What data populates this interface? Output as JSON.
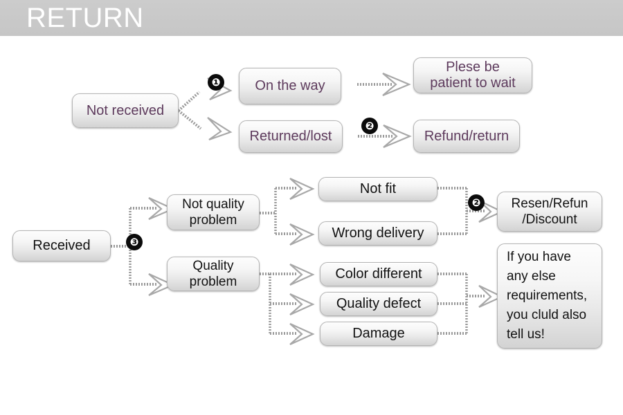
{
  "header": {
    "title": "RETURN",
    "bar_color": "#c8c8c8",
    "title_color": "#ffffff"
  },
  "theme": {
    "purple_text": "#5d3a5c",
    "black_text": "#111111",
    "box_border": "#b4b4b4",
    "connector": "#9a9a9a",
    "badge_bg": "#0b0b0b"
  },
  "nodes": {
    "not_received": "Not received",
    "on_the_way": "On the way",
    "returned_lost": "Returned/lost",
    "please_wait": "Plese be\npatient to wait",
    "refund_return": "Refund/return",
    "received": "Received",
    "not_quality_problem": "Not quality\nproblem",
    "quality_problem": "Quality\nproblem",
    "not_fit": "Not fit",
    "wrong_delivery": "Wrong delivery",
    "color_different": "Color different",
    "quality_defect": "Quality defect",
    "damage": "Damage",
    "resend_refund_discount": "Resen/Refun\n/Discount",
    "contact_us": "If you have\nany else\nrequirements,\nyou cluld also\ntell us!"
  },
  "badges": {
    "one": "❶",
    "two": "❷",
    "three": "❸"
  },
  "chart_data": {
    "type": "diagram",
    "title": "RETURN",
    "flows": [
      {
        "step": "1",
        "from": "Not received",
        "to": "On the way",
        "then": "Plese be patient to wait"
      },
      {
        "step": "2",
        "from": "Not received",
        "to": "Returned/lost",
        "then": "Refund/return"
      },
      {
        "step": "3",
        "from": "Received",
        "to": [
          "Not quality problem",
          "Quality problem"
        ]
      },
      {
        "from": "Not quality problem",
        "to": [
          "Not fit",
          "Wrong delivery"
        ],
        "then": "Resen/Refun /Discount"
      },
      {
        "from": "Quality problem",
        "to": [
          "Color different",
          "Quality defect",
          "Damage"
        ],
        "then": "If you have any else requirements, you cluld also tell us!"
      }
    ]
  }
}
